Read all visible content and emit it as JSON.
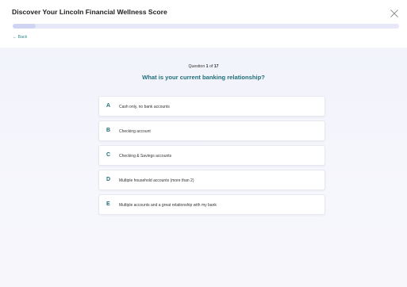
{
  "header": {
    "title": "Discover Your Lincoln Financial Wellness Score",
    "back_label": "← Back",
    "progress_fraction": 0.0588
  },
  "question": {
    "count_prefix": "Question ",
    "current": "1",
    "count_mid": " of ",
    "total": "17",
    "text": "What is your current banking relationship?"
  },
  "options": [
    {
      "letter": "A",
      "text": "Cash only, no bank accounts"
    },
    {
      "letter": "B",
      "text": "Checking account"
    },
    {
      "letter": "C",
      "text": "Checking & Savings accounts"
    },
    {
      "letter": "D",
      "text": "Multiple household accounts (more than 2)"
    },
    {
      "letter": "E",
      "text": "Multiple accounts and a great relationship with my bank"
    }
  ],
  "colors": {
    "accent": "#1f6e78",
    "link": "#2e8b88",
    "progress_track": "#e6e8f8"
  },
  "icons": {
    "close": "close-icon"
  }
}
